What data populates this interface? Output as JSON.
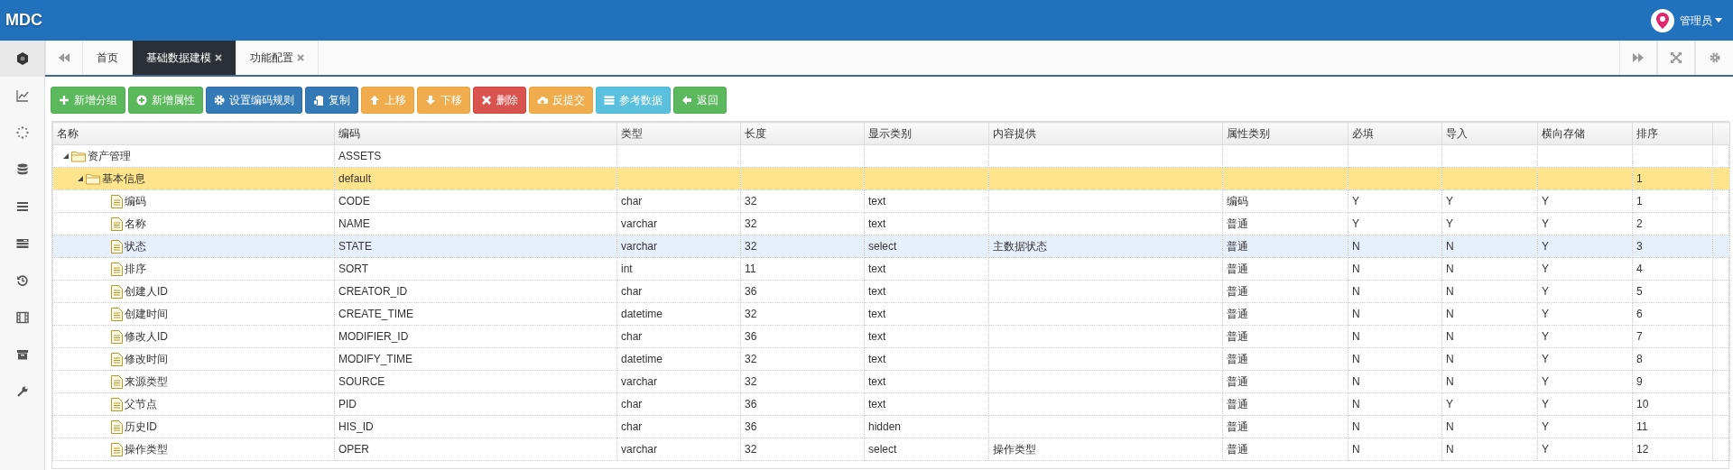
{
  "header": {
    "logo": "MDC",
    "user": "管理员"
  },
  "sidebar": {
    "items": [
      {
        "selected": true
      },
      {
        "selected": false
      },
      {
        "selected": false
      },
      {
        "selected": false
      },
      {
        "selected": false
      },
      {
        "selected": false
      },
      {
        "selected": false
      },
      {
        "selected": false
      },
      {
        "selected": false
      },
      {
        "selected": false
      }
    ]
  },
  "tabs": [
    {
      "label": "首页",
      "selected": false,
      "closable": false
    },
    {
      "label": "基础数据建模",
      "selected": true,
      "closable": true
    },
    {
      "label": "功能配置",
      "selected": false,
      "closable": true
    }
  ],
  "toolbar": [
    {
      "label": "新增分组"
    },
    {
      "label": "新增属性"
    },
    {
      "label": "设置编码规则"
    },
    {
      "label": "复制"
    },
    {
      "label": "上移"
    },
    {
      "label": "下移"
    },
    {
      "label": "删除"
    },
    {
      "label": "反提交"
    },
    {
      "label": "参考数据"
    },
    {
      "label": "返回"
    }
  ],
  "table": {
    "columns": [
      "名称",
      "编码",
      "类型",
      "长度",
      "显示类别",
      "内容提供",
      "属性类别",
      "必填",
      "导入",
      "横向存储",
      "排序"
    ],
    "rows": [
      {
        "kind": "group",
        "expanded": true,
        "selected": false,
        "hovered": false,
        "cells": [
          "资产管理",
          "ASSETS",
          "",
          "",
          "",
          "",
          "",
          "",
          "",
          "",
          ""
        ],
        "children": [
          {
            "kind": "group",
            "expanded": true,
            "selected": true,
            "hovered": false,
            "cells": [
              "基本信息",
              "default",
              "",
              "",
              "",
              "",
              "",
              "",
              "",
              "",
              "1"
            ],
            "children": [
              {
                "kind": "field",
                "selected": false,
                "hovered": false,
                "cells": [
                  "编码",
                  "CODE",
                  "char",
                  "32",
                  "text",
                  "",
                  "编码",
                  "Y",
                  "Y",
                  "Y",
                  "1"
                ]
              },
              {
                "kind": "field",
                "selected": false,
                "hovered": false,
                "cells": [
                  "名称",
                  "NAME",
                  "varchar",
                  "32",
                  "text",
                  "",
                  "普通",
                  "Y",
                  "Y",
                  "Y",
                  "2"
                ]
              },
              {
                "kind": "field",
                "selected": false,
                "hovered": true,
                "cells": [
                  "状态",
                  "STATE",
                  "varchar",
                  "32",
                  "select",
                  "主数据状态",
                  "普通",
                  "N",
                  "N",
                  "Y",
                  "3"
                ]
              },
              {
                "kind": "field",
                "selected": false,
                "hovered": false,
                "cells": [
                  "排序",
                  "SORT",
                  "int",
                  "11",
                  "text",
                  "",
                  "普通",
                  "N",
                  "N",
                  "Y",
                  "4"
                ]
              },
              {
                "kind": "field",
                "selected": false,
                "hovered": false,
                "cells": [
                  "创建人ID",
                  "CREATOR_ID",
                  "char",
                  "36",
                  "text",
                  "",
                  "普通",
                  "N",
                  "N",
                  "Y",
                  "5"
                ]
              },
              {
                "kind": "field",
                "selected": false,
                "hovered": false,
                "cells": [
                  "创建时间",
                  "CREATE_TIME",
                  "datetime",
                  "32",
                  "text",
                  "",
                  "普通",
                  "N",
                  "N",
                  "Y",
                  "6"
                ]
              },
              {
                "kind": "field",
                "selected": false,
                "hovered": false,
                "cells": [
                  "修改人ID",
                  "MODIFIER_ID",
                  "char",
                  "36",
                  "text",
                  "",
                  "普通",
                  "N",
                  "N",
                  "Y",
                  "7"
                ]
              },
              {
                "kind": "field",
                "selected": false,
                "hovered": false,
                "cells": [
                  "修改时间",
                  "MODIFY_TIME",
                  "datetime",
                  "32",
                  "text",
                  "",
                  "普通",
                  "N",
                  "N",
                  "Y",
                  "8"
                ]
              },
              {
                "kind": "field",
                "selected": false,
                "hovered": false,
                "cells": [
                  "来源类型",
                  "SOURCE",
                  "varchar",
                  "32",
                  "text",
                  "",
                  "普通",
                  "N",
                  "N",
                  "Y",
                  "9"
                ]
              },
              {
                "kind": "field",
                "selected": false,
                "hovered": false,
                "cells": [
                  "父节点",
                  "PID",
                  "char",
                  "36",
                  "text",
                  "",
                  "普通",
                  "N",
                  "Y",
                  "Y",
                  "10"
                ]
              },
              {
                "kind": "field",
                "selected": false,
                "hovered": false,
                "cells": [
                  "历史ID",
                  "HIS_ID",
                  "char",
                  "36",
                  "hidden",
                  "",
                  "普通",
                  "N",
                  "N",
                  "Y",
                  "11"
                ]
              },
              {
                "kind": "field",
                "selected": false,
                "hovered": false,
                "cells": [
                  "操作类型",
                  "OPER",
                  "varchar",
                  "32",
                  "select",
                  "操作类型",
                  "普通",
                  "N",
                  "N",
                  "Y",
                  "12"
                ]
              }
            ]
          }
        ]
      }
    ]
  }
}
